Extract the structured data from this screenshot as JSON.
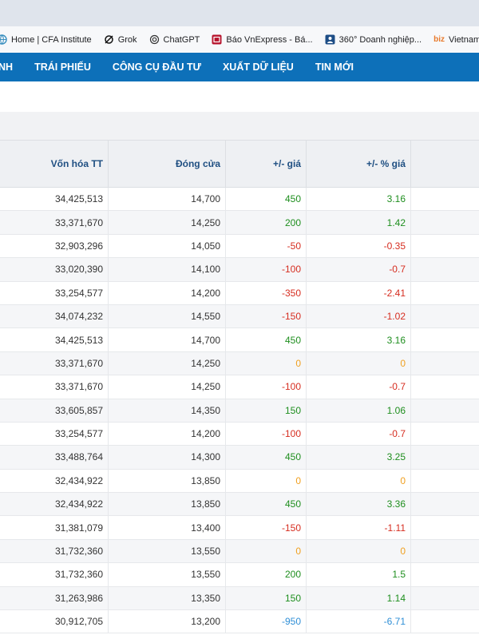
{
  "bookmarks": [
    {
      "label": "Home | CFA Institute",
      "icon": "cfa-globe-icon"
    },
    {
      "label": "Grok",
      "icon": "grok-icon"
    },
    {
      "label": "ChatGPT",
      "icon": "chatgpt-icon"
    },
    {
      "label": "Báo VnExpress - Bá...",
      "icon": "vnexpress-icon"
    },
    {
      "label": "360° Doanh nghiệp...",
      "icon": "doanh-nghiep-icon"
    },
    {
      "label": "VietnamBiz",
      "icon_text": "biz",
      "icon": "vietnambiz-icon"
    }
  ],
  "nav": {
    "partial": "NH",
    "items": [
      "TRÁI PHIẾU",
      "CÔNG CỤ ĐẦU TƯ",
      "XUẤT DỮ LIỆU",
      "TIN MỚI"
    ]
  },
  "colors": {
    "nav_bg": "#0d70b9",
    "header_text": "#1f4f82",
    "up": "#1e8e1e",
    "down": "#d62d20",
    "unchanged": "#f0a020",
    "floor": "#2f8fd6"
  },
  "table": {
    "headers": [
      "Vốn hóa TT",
      "Đóng cửa",
      "+/- giá",
      "+/- % giá"
    ],
    "rows": [
      {
        "cap": "34,425,513",
        "close": "14,700",
        "chg": "450",
        "pct": "3.16",
        "dir": "up"
      },
      {
        "cap": "33,371,670",
        "close": "14,250",
        "chg": "200",
        "pct": "1.42",
        "dir": "up"
      },
      {
        "cap": "32,903,296",
        "close": "14,050",
        "chg": "-50",
        "pct": "-0.35",
        "dir": "down"
      },
      {
        "cap": "33,020,390",
        "close": "14,100",
        "chg": "-100",
        "pct": "-0.7",
        "dir": "down"
      },
      {
        "cap": "33,254,577",
        "close": "14,200",
        "chg": "-350",
        "pct": "-2.41",
        "dir": "down"
      },
      {
        "cap": "34,074,232",
        "close": "14,550",
        "chg": "-150",
        "pct": "-1.02",
        "dir": "down"
      },
      {
        "cap": "34,425,513",
        "close": "14,700",
        "chg": "450",
        "pct": "3.16",
        "dir": "up"
      },
      {
        "cap": "33,371,670",
        "close": "14,250",
        "chg": "0",
        "pct": "0",
        "dir": "flat"
      },
      {
        "cap": "33,371,670",
        "close": "14,250",
        "chg": "-100",
        "pct": "-0.7",
        "dir": "down"
      },
      {
        "cap": "33,605,857",
        "close": "14,350",
        "chg": "150",
        "pct": "1.06",
        "dir": "up"
      },
      {
        "cap": "33,254,577",
        "close": "14,200",
        "chg": "-100",
        "pct": "-0.7",
        "dir": "down"
      },
      {
        "cap": "33,488,764",
        "close": "14,300",
        "chg": "450",
        "pct": "3.25",
        "dir": "up"
      },
      {
        "cap": "32,434,922",
        "close": "13,850",
        "chg": "0",
        "pct": "0",
        "dir": "flat"
      },
      {
        "cap": "32,434,922",
        "close": "13,850",
        "chg": "450",
        "pct": "3.36",
        "dir": "up"
      },
      {
        "cap": "31,381,079",
        "close": "13,400",
        "chg": "-150",
        "pct": "-1.11",
        "dir": "down"
      },
      {
        "cap": "31,732,360",
        "close": "13,550",
        "chg": "0",
        "pct": "0",
        "dir": "flat"
      },
      {
        "cap": "31,732,360",
        "close": "13,550",
        "chg": "200",
        "pct": "1.5",
        "dir": "up"
      },
      {
        "cap": "31,263,986",
        "close": "13,350",
        "chg": "150",
        "pct": "1.14",
        "dir": "up"
      },
      {
        "cap": "30,912,705",
        "close": "13,200",
        "chg": "-950",
        "pct": "-6.71",
        "dir": "floor"
      }
    ]
  }
}
